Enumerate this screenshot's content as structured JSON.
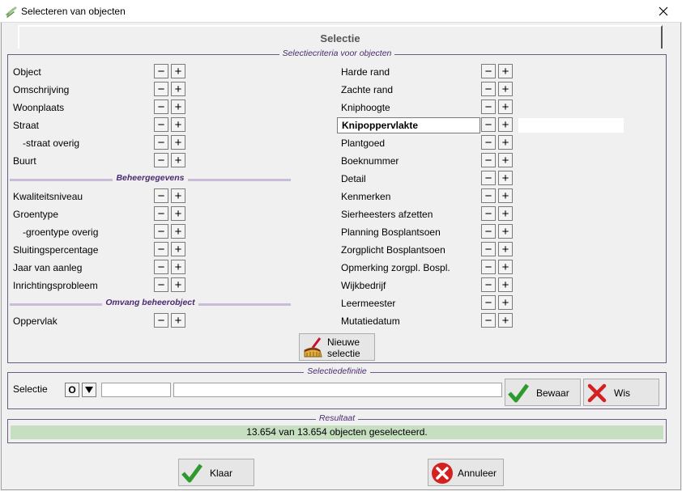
{
  "window": {
    "title": "Selecteren van objecten"
  },
  "tab": {
    "label": "Selectie"
  },
  "criteria": {
    "legend": "Selectiecriteria voor objecten",
    "left_rows": [
      {
        "label": "Object"
      },
      {
        "label": "Omschrijving"
      },
      {
        "label": "Woonplaats"
      },
      {
        "label": "Straat"
      },
      {
        "label": "-straat overig"
      },
      {
        "label": "Buurt"
      }
    ],
    "beheer_heading": "Beheergegevens",
    "beheer_rows": [
      {
        "label": "Kwaliteitsniveau"
      },
      {
        "label": "Groentype"
      },
      {
        "label": "-groentype overig"
      },
      {
        "label": "Sluitingspercentage"
      },
      {
        "label": "Jaar van aanleg"
      },
      {
        "label": "Inrichtingsprobleem"
      }
    ],
    "omvang_heading": "Omvang beheerobject",
    "omvang_rows": [
      {
        "label": "Oppervlak"
      }
    ],
    "right_rows": [
      {
        "label": "Harde rand"
      },
      {
        "label": "Zachte rand"
      },
      {
        "label": "Kniphoogte"
      },
      {
        "label": "Knipoppervlakte"
      },
      {
        "label": "Plantgoed"
      },
      {
        "label": "Boeknummer"
      },
      {
        "label": "Detail"
      },
      {
        "label": "Kenmerken"
      },
      {
        "label": "Sierheesters afzetten"
      },
      {
        "label": "Planning Bosplantsoen"
      },
      {
        "label": "Zorgplicht Bosplantsoen"
      },
      {
        "label": "Opmerking zorgpl. Bospl."
      },
      {
        "label": "Wijkbedrijf"
      },
      {
        "label": "Leermeester"
      },
      {
        "label": "Mutatiedatum"
      }
    ],
    "active_field": "Knipoppervlakte",
    "new_selection_line1": "Nieuwe",
    "new_selection_line2": "selectie"
  },
  "definition": {
    "legend": "Selectiedefinitie",
    "label": "Selectie",
    "o_button": "O",
    "field1_value": "",
    "field2_value": "",
    "save_label": "Bewaar",
    "clear_label": "Wis"
  },
  "result": {
    "legend": "Resultaat",
    "text": "13.654 van 13.654 objecten geselecteerd."
  },
  "footer": {
    "ok_label": "Klaar",
    "cancel_label": "Annuleer"
  },
  "colors": {
    "accent_purple": "#4a2a70",
    "result_green": "#c6dfc0",
    "check_green": "#2e9a2e",
    "cross_red": "#d42020"
  }
}
